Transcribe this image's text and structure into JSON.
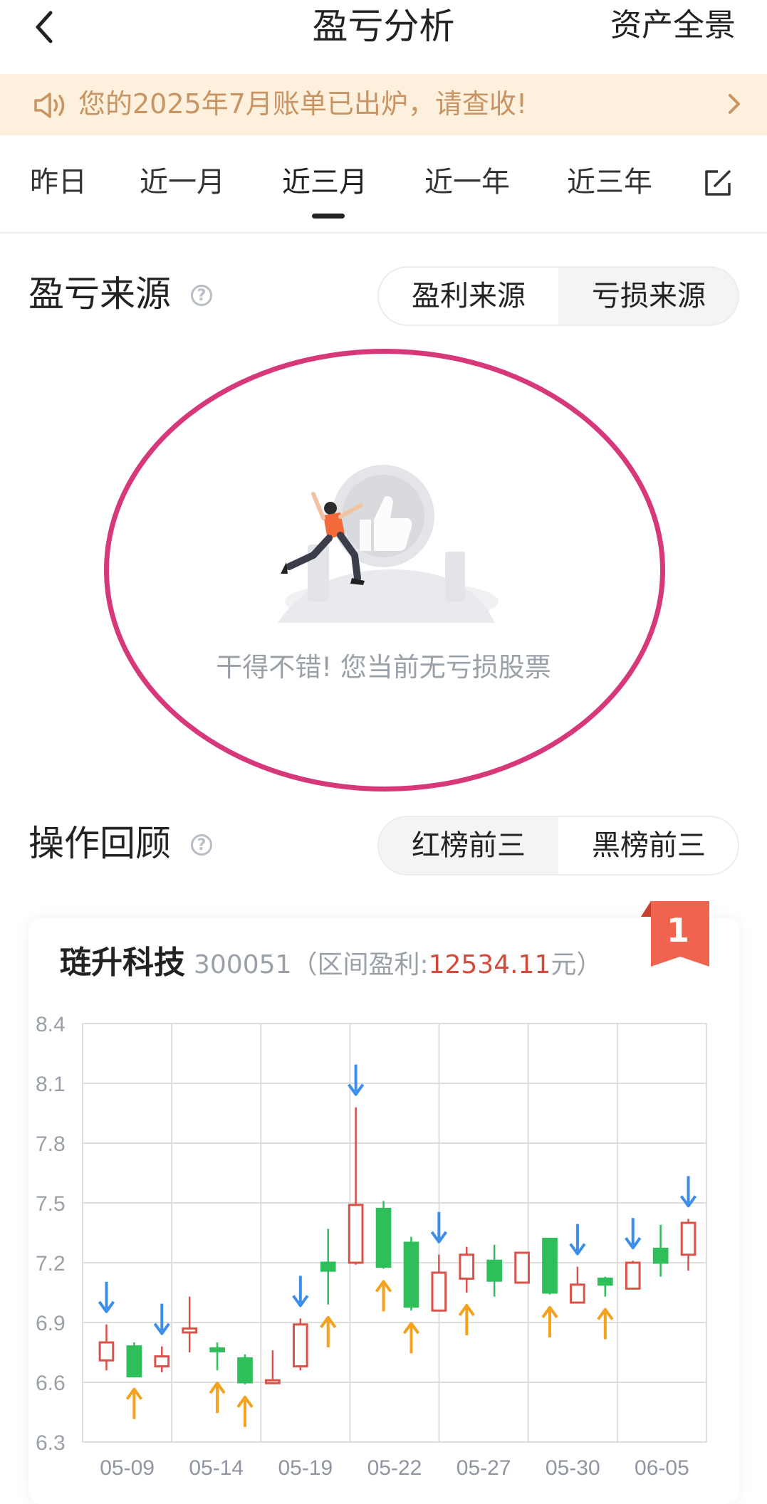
{
  "header": {
    "title": "盈亏分析",
    "right_label": "资产全景"
  },
  "banner": {
    "text": "您的2025年7月账单已出炉，请查收!"
  },
  "tabs": [
    {
      "label": "昨日",
      "active": false
    },
    {
      "label": "近一月",
      "active": false
    },
    {
      "label": "近三月",
      "active": true
    },
    {
      "label": "近一年",
      "active": false
    },
    {
      "label": "近三年",
      "active": false
    }
  ],
  "profit_source": {
    "title": "盈亏来源",
    "help": "?",
    "toggle": [
      "盈利来源",
      "亏损来源"
    ],
    "active_toggle": "亏损来源",
    "empty_text": "干得不错!  您当前无亏损股票"
  },
  "review": {
    "title": "操作回顾",
    "help": "?",
    "toggle": [
      "红榜前三",
      "黑榜前三"
    ],
    "active_toggle": "红榜前三"
  },
  "card": {
    "rank": "1",
    "name": "琏升科技",
    "code": "300051",
    "paren_open": "（区间盈利:",
    "profit": "12534.11",
    "paren_close": "元）"
  },
  "colors": {
    "up": "#d9534a",
    "down": "#2fbf5a",
    "buy_arrow": "#f5a11c",
    "sell_arrow": "#3d8ee8",
    "highlight": "#d6387a"
  },
  "chart_data": {
    "type": "candlestick",
    "ylim": [
      6.3,
      8.4
    ],
    "y_ticks": [
      "8.4",
      "8.1",
      "7.8",
      "7.5",
      "7.2",
      "6.9",
      "6.6",
      "6.3"
    ],
    "x_labels": [
      "05-09",
      "05-14",
      "05-19",
      "05-22",
      "05-27",
      "05-30",
      "06-05"
    ],
    "candles": [
      {
        "open": 6.71,
        "close": 6.8,
        "high": 6.89,
        "low": 6.66,
        "marker": "sell"
      },
      {
        "open": 6.78,
        "close": 6.63,
        "high": 6.8,
        "low": 6.63,
        "marker": "buy"
      },
      {
        "open": 6.68,
        "close": 6.73,
        "high": 6.78,
        "low": 6.65,
        "marker": "sell"
      },
      {
        "open": 6.85,
        "close": 6.87,
        "high": 7.03,
        "low": 6.75,
        "marker": ""
      },
      {
        "open": 6.77,
        "close": 6.76,
        "high": 6.8,
        "low": 6.66,
        "marker": "buy"
      },
      {
        "open": 6.72,
        "close": 6.6,
        "high": 6.74,
        "low": 6.59,
        "marker": "buy"
      },
      {
        "open": 6.6,
        "close": 6.61,
        "high": 6.76,
        "low": 6.6,
        "marker": ""
      },
      {
        "open": 6.68,
        "close": 6.89,
        "high": 6.92,
        "low": 6.66,
        "marker": "sell"
      },
      {
        "open": 7.2,
        "close": 7.16,
        "high": 7.37,
        "low": 6.99,
        "marker": "buy"
      },
      {
        "open": 7.2,
        "close": 7.49,
        "high": 7.98,
        "low": 7.19,
        "marker": "sell"
      },
      {
        "open": 7.47,
        "close": 7.18,
        "high": 7.51,
        "low": 7.17,
        "marker": "buy"
      },
      {
        "open": 7.3,
        "close": 6.98,
        "high": 7.33,
        "low": 6.96,
        "marker": "buy"
      },
      {
        "open": 6.96,
        "close": 7.15,
        "high": 7.24,
        "low": 6.96,
        "marker": "sell"
      },
      {
        "open": 7.12,
        "close": 7.24,
        "high": 7.28,
        "low": 7.05,
        "marker": "buy"
      },
      {
        "open": 7.21,
        "close": 7.11,
        "high": 7.29,
        "low": 7.03,
        "marker": ""
      },
      {
        "open": 7.1,
        "close": 7.25,
        "high": 7.25,
        "low": 7.1,
        "marker": ""
      },
      {
        "open": 7.32,
        "close": 7.05,
        "high": 7.32,
        "low": 7.04,
        "marker": "buy"
      },
      {
        "open": 7.0,
        "close": 7.09,
        "high": 7.18,
        "low": 7.0,
        "marker": "sell"
      },
      {
        "open": 7.12,
        "close": 7.09,
        "high": 7.13,
        "low": 7.03,
        "marker": "buy"
      },
      {
        "open": 7.07,
        "close": 7.2,
        "high": 7.21,
        "low": 7.07,
        "marker": "sell"
      },
      {
        "open": 7.27,
        "close": 7.2,
        "high": 7.39,
        "low": 7.13,
        "marker": ""
      },
      {
        "open": 7.24,
        "close": 7.4,
        "high": 7.42,
        "low": 7.16,
        "marker": "sell"
      }
    ]
  }
}
